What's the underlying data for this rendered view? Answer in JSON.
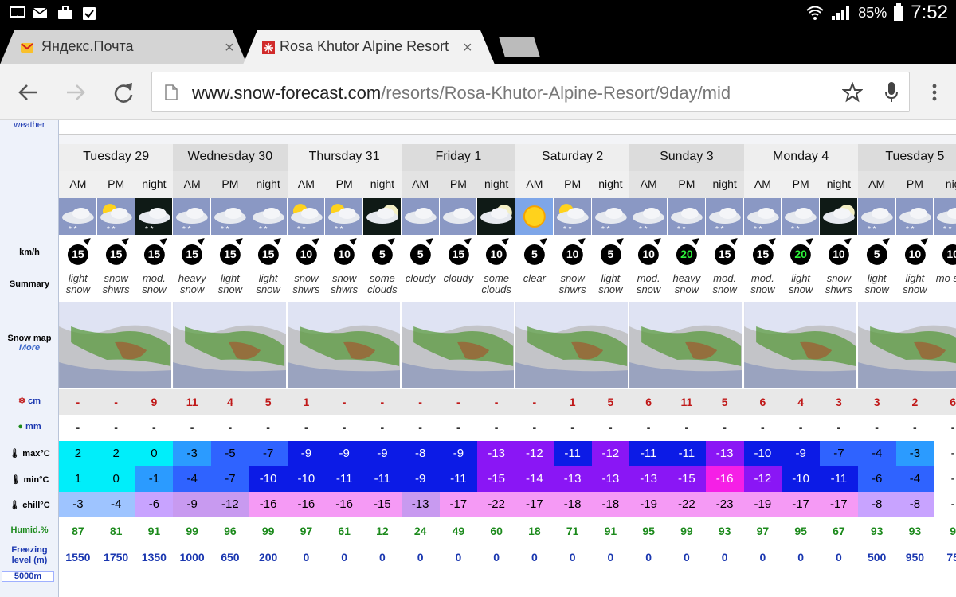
{
  "status_bar": {
    "battery": "85%",
    "time": "7:52"
  },
  "tabs": [
    {
      "title": "Яндекс.Почта",
      "close": "×"
    },
    {
      "title": "Rosa Khutor Alpine Resort",
      "close": "×"
    }
  ],
  "toolbar": {
    "url_host": "www.snow-forecast.com",
    "url_path": "/resorts/Rosa-Khutor-Alpine-Resort/9day/mid"
  },
  "row_labels": {
    "weather": "weather",
    "wind": "km/h",
    "summary": "Summary",
    "snow_map": "Snow map",
    "snow_map_more": "More",
    "snow_cm": "cm",
    "rain_mm": "mm",
    "max": "max°C",
    "min": "min°C",
    "chill": "chill°C",
    "humid": "Humid.%",
    "freezing": "Freezing level (m)",
    "level_5000": "5000m"
  },
  "days": [
    {
      "name": "Tuesday 29",
      "periods": [
        "AM",
        "PM",
        "night"
      ]
    },
    {
      "name": "Wednesday 30",
      "periods": [
        "AM",
        "PM",
        "night"
      ]
    },
    {
      "name": "Thursday 31",
      "periods": [
        "AM",
        "PM",
        "night"
      ]
    },
    {
      "name": "Friday 1",
      "periods": [
        "AM",
        "PM",
        "night"
      ]
    },
    {
      "name": "Saturday 2",
      "periods": [
        "AM",
        "PM",
        "night"
      ]
    },
    {
      "name": "Sunday 3",
      "periods": [
        "AM",
        "PM",
        "night"
      ]
    },
    {
      "name": "Monday 4",
      "periods": [
        "AM",
        "PM",
        "night"
      ]
    },
    {
      "name": "Tuesday 5",
      "periods": [
        "AM",
        "PM",
        "nig"
      ]
    }
  ],
  "forecast": {
    "icons": [
      "cloud-snow",
      "sun-cloud-snow",
      "night-cloud-snow",
      "cloud-snow",
      "cloud-snow",
      "cloud-snow",
      "sun-cloud-snow",
      "sun-cloud-snow",
      "moon-cloud",
      "cloud",
      "cloud",
      "moon-cloud",
      "sun",
      "sun-cloud-snow",
      "cloud-snow",
      "cloud-snow",
      "cloud-snow",
      "cloud-snow",
      "cloud-snow",
      "cloud-snow",
      "moon-cloud",
      "cloud-snow",
      "cloud-snow",
      "cloud-snow"
    ],
    "wind": [
      15,
      15,
      15,
      15,
      15,
      15,
      10,
      10,
      5,
      5,
      15,
      10,
      5,
      10,
      5,
      10,
      20,
      15,
      15,
      20,
      10,
      5,
      10,
      10
    ],
    "wind_highlight": [
      false,
      false,
      false,
      false,
      false,
      false,
      false,
      false,
      false,
      false,
      false,
      false,
      false,
      false,
      false,
      false,
      true,
      false,
      false,
      true,
      false,
      false,
      false,
      false
    ],
    "summary": [
      "light snow",
      "snow shwrs",
      "mod. snow",
      "heavy snow",
      "light snow",
      "light snow",
      "snow shwrs",
      "snow shwrs",
      "some clouds",
      "cloudy",
      "cloudy",
      "some clouds",
      "clear",
      "snow shwrs",
      "light snow",
      "mod. snow",
      "heavy snow",
      "mod. snow",
      "mod. snow",
      "light snow",
      "snow shwrs",
      "light snow",
      "light snow",
      "mo sno"
    ],
    "snow_cm": [
      "-",
      "-",
      "9",
      "11",
      "4",
      "5",
      "1",
      "-",
      "-",
      "-",
      "-",
      "-",
      "-",
      "1",
      "5",
      "6",
      "11",
      "5",
      "6",
      "4",
      "3",
      "3",
      "2",
      "6"
    ],
    "rain_mm": [
      "-",
      "-",
      "-",
      "-",
      "-",
      "-",
      "-",
      "-",
      "-",
      "-",
      "-",
      "-",
      "-",
      "-",
      "-",
      "-",
      "-",
      "-",
      "-",
      "-",
      "-",
      "-",
      "-",
      "-"
    ],
    "max": [
      "2",
      "2",
      "0",
      "-3",
      "-5",
      "-7",
      "-9",
      "-9",
      "-9",
      "-8",
      "-9",
      "-13",
      "-12",
      "-11",
      "-12",
      "-11",
      "-11",
      "-13",
      "-10",
      "-9",
      "-7",
      "-4",
      "-3",
      "-"
    ],
    "min": [
      "1",
      "0",
      "-1",
      "-4",
      "-7",
      "-10",
      "-10",
      "-11",
      "-11",
      "-9",
      "-11",
      "-15",
      "-14",
      "-13",
      "-13",
      "-13",
      "-15",
      "-16",
      "-12",
      "-10",
      "-11",
      "-6",
      "-4",
      "-"
    ],
    "chill": [
      "-3",
      "-4",
      "-6",
      "-9",
      "-12",
      "-16",
      "-16",
      "-16",
      "-15",
      "-13",
      "-17",
      "-22",
      "-17",
      "-18",
      "-18",
      "-19",
      "-22",
      "-23",
      "-19",
      "-17",
      "-17",
      "-8",
      "-8",
      "-"
    ],
    "humid": [
      "87",
      "81",
      "91",
      "99",
      "96",
      "99",
      "97",
      "61",
      "12",
      "24",
      "49",
      "60",
      "18",
      "71",
      "91",
      "95",
      "99",
      "93",
      "97",
      "95",
      "67",
      "93",
      "93",
      "9"
    ],
    "freezing": [
      "1550",
      "1750",
      "1350",
      "1000",
      "650",
      "200",
      "0",
      "0",
      "0",
      "0",
      "0",
      "0",
      "0",
      "0",
      "0",
      "0",
      "0",
      "0",
      "0",
      "0",
      "0",
      "500",
      "950",
      "75"
    ]
  },
  "temp_colors": {
    "cyan": "#00eefa",
    "lightblue": "#2b9bff",
    "blue": "#2f63ff",
    "deepblue": "#0c1be6",
    "purple": "#8a16f5",
    "violet": "#a55ff5",
    "magenta": "#f51fe6",
    "pink": "#f59af5",
    "lavender": "#c8a3ff"
  },
  "colors": {
    "snow_text": "#c01818",
    "humid_text": "#1c8a1c",
    "freezing_text": "#1a37b0"
  }
}
